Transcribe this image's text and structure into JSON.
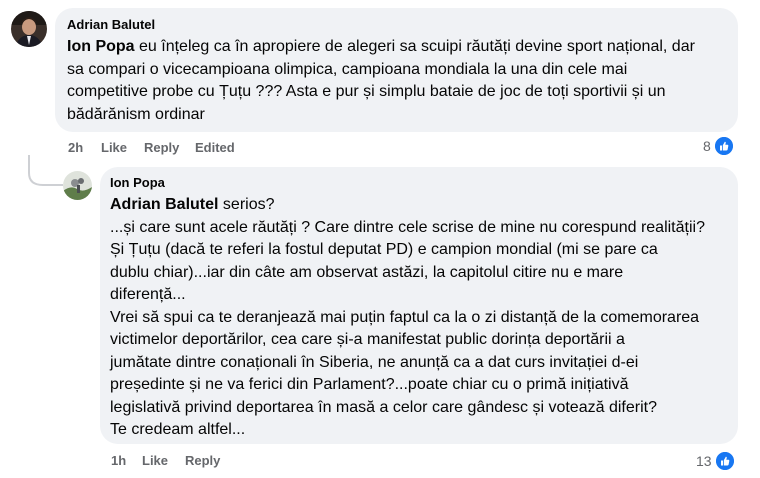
{
  "comment": {
    "author": "Adrian Balutel",
    "mention": "Ion Popa",
    "lines": [
      " eu înțeleg ca în apropiere de alegeri sa scuipi răutăți devine sport național, dar",
      "sa compari o vicecampioana olimpica, campioana mondiala la una din cele mai",
      "competitive probe cu Țuțu ??? Asta e pur și simplu bataie de joc de toți sportivii și un",
      "bădărănism ordinar"
    ],
    "time": "2h",
    "like": "Like",
    "reply": "Reply",
    "edited": "Edited",
    "reaction_count": "8"
  },
  "reply": {
    "author": "Ion Popa",
    "mention": "Adrian Balutel",
    "first_line_rest": " serios?",
    "lines": [
      "...și care sunt acele răutăți ? Care dintre cele scrise de mine nu corespund realității?",
      "Și Țuțu (dacă te referi la fostul deputat PD) e campion mondial (mi se pare ca",
      "dublu chiar)...iar din câte am observat astăzi, la capitolul citire nu e mare",
      "diferență...",
      "Vrei să spui ca te deranjează mai puțin faptul ca la o zi distanță de la comemorarea",
      "victimelor deportărilor, cea care și-a manifestat public dorința deportării a",
      "jumătate dintre conaționali în Siberia, ne anunță ca a dat curs invitației d-ei",
      "președinte și ne va ferici din Parlament?...poate chiar cu o primă inițiativă",
      "legislativă privind deportarea în masă a celor care gândesc și votează diferit?",
      "Te credeam altfel..."
    ],
    "time": "1h",
    "like": "Like",
    "reply": "Reply",
    "reaction_count": "13"
  },
  "colors": {
    "bubble": "#f0f2f5",
    "like_blue": "#1877f2",
    "meta_gray": "#65676b"
  },
  "icons": {
    "reaction": "thumbs-up-icon"
  }
}
